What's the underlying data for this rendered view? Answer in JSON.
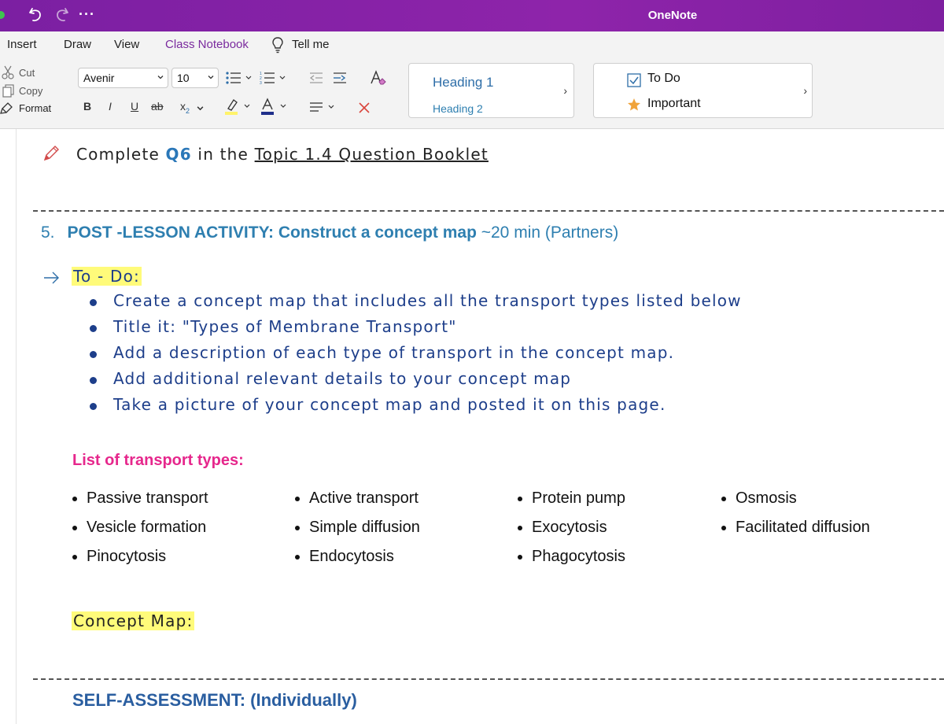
{
  "app": {
    "title": "OneNote",
    "more": "···"
  },
  "menu": {
    "items": [
      "Insert",
      "Draw",
      "View",
      "Class Notebook",
      "Tell me"
    ]
  },
  "ribbon": {
    "clipboard": {
      "cut": "Cut",
      "copy": "Copy",
      "format": "Format"
    },
    "font": {
      "family": "Avenir",
      "size": "10"
    },
    "styles": {
      "heading1": "Heading 1",
      "heading2": "Heading 2"
    },
    "tags": {
      "todo": "To Do",
      "important": "Important"
    }
  },
  "page": {
    "line1": {
      "prefix": "Complete ",
      "q": "Q6",
      "middle": " in the ",
      "link": "Topic 1.4 Question Booklet"
    },
    "section5": {
      "number": "5.",
      "title": "POST -LESSON ACTIVITY: Construct a concept map",
      "extra": " ~20 min (Partners)"
    },
    "todo_label": "To - Do:",
    "todo_items": [
      "Create a concept map that includes all the transport types listed below",
      "Title it: \"Types of Membrane Transport\"",
      "Add a description of each type of transport in the concept map.",
      "Add additional relevant details to your concept map",
      "Take a picture of your concept map and posted it on this page."
    ],
    "list_title": "List of transport types:",
    "transport_columns": [
      [
        "Passive transport",
        "Vesicle formation",
        "Pinocytosis"
      ],
      [
        "Active transport",
        "Simple diffusion",
        "Endocytosis"
      ],
      [
        "Protein pump",
        "Exocytosis",
        "Phagocytosis"
      ],
      [
        "Osmosis",
        "Facilitated diffusion"
      ]
    ],
    "concept_label": "Concept Map:",
    "self_assessment": "SELF-ASSESSMENT: (Individually)"
  },
  "colors": {
    "titlebar": "#8e24aa",
    "accent": "#7a2a9e",
    "heading": "#2e7fb0",
    "handwriting": "#1d3e8a",
    "pink": "#e6278c",
    "highlight": "#fffb7a"
  }
}
